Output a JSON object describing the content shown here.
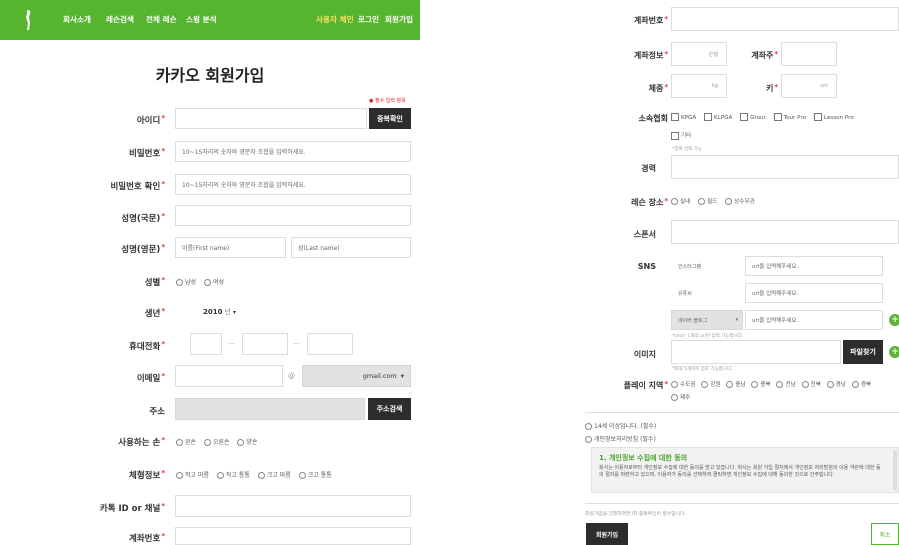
{
  "nav": {
    "items": [
      "회사소개",
      "레슨검색",
      "전체 레슨",
      "스윙 분석"
    ],
    "right": [
      "사용자 체인",
      "로그인",
      "회원가입"
    ]
  },
  "form": {
    "title": "카카오 회원가입",
    "required_note": "● 필수 입력 항목",
    "id_label": "아이디",
    "dup_check_button": "중복확인",
    "pw_label": "비밀번호",
    "pw_placeholder": "10~15자리의 숫자와 영문자 조합을 입력하세요.",
    "pw_confirm_label": "비밀번호 확인",
    "pw_confirm_placeholder": "10~15자리의 숫자와 영문자 조합을 입력하세요.",
    "name_kr_label": "성명(국문)",
    "name_en_label": "성명(영문)",
    "first_name_placeholder": "이름(First name)",
    "last_name_placeholder": "성(Last name)",
    "gender_label": "성별",
    "gender_options": [
      "남성",
      "여성"
    ],
    "birth_label": "생년",
    "birth_year": "2010",
    "birth_unit": "년",
    "phone_label": "휴대전화",
    "phone_sep": "—",
    "email_label": "이메일",
    "email_at": "@",
    "email_domain": "gmail.com",
    "address_label": "주소",
    "address_button": "주소검색",
    "hand_label": "사용하는 손",
    "hand_options": [
      "왼손",
      "오른손",
      "양손"
    ],
    "body_label": "체형정보",
    "body_options": [
      "작고 마름",
      "작고 통통",
      "크고 마름",
      "크고 통통"
    ],
    "kakao_label": "카톡 ID or 채널",
    "account_label": "계좌번호"
  },
  "right": {
    "account_no_label": "계좌번호",
    "account_info_label": "계좌정보",
    "bank_unit": "은행",
    "holder_label": "계좌주",
    "weight_label": "체중",
    "weight_unit": "kg",
    "height_label": "키",
    "height_unit": "cm",
    "assoc_label": "소속협회",
    "assoc_options": [
      "KPGA",
      "KLPGA",
      "Gtour",
      "Tour Pro",
      "Lesson Pro",
      "기타"
    ],
    "assoc_hint": "*중복 선택 가능",
    "career_label": "경력",
    "lesson_place_label": "레슨 장소",
    "lesson_place_options": [
      "실내",
      "필드",
      "상수무관"
    ],
    "sponsor_label": "스폰서",
    "sns_label": "SNS",
    "sns_rows": [
      {
        "name": "인스타그램",
        "placeholder": "url을 입력해주세요."
      },
      {
        "name": "유튜브",
        "placeholder": "url을 입력해주세요."
      },
      {
        "name": "네이버 블로그",
        "placeholder": "url을 입력해주세요."
      }
    ],
    "sns_hint": "*sns는 1개의 url만 입력 가능합니다.",
    "image_label": "이미지",
    "file_button": "파일찾기",
    "image_hint": "*최대 5개까지 업로 가능합니다.",
    "region_label": "플레이 지역",
    "region_options": [
      "수도권",
      "강원",
      "충남",
      "충북",
      "전남",
      "전북",
      "경남",
      "경북",
      "제주"
    ],
    "agree_age": "14세 이상입니다. (필수)",
    "agree_privacy": "개인정보처리방침 (필수)",
    "privacy_title": "1. 개인정보 수집에 대한 동의",
    "privacy_text": "회사는 이용자로부터 개인정보 수집에 대한 동의를 받고 있습니다. 회사는 회원 가입 절차에서 개인정보 처리방침의 이용 약관에 대한 동의 절차를 마련하고 있으며, 이용자가 동의를 선택하여 클릭하면 개인정보 수집에 대해 동의한 것으로 간주합니다.",
    "bottom_note": "회원가입을 진행하려면 ID 중복확인이 필수입니다.",
    "signup_button": "회원가입",
    "cancel_button": "취소"
  },
  "colors": {
    "nav": "#56b52f",
    "accent": "#e8252a",
    "button": "#2d2d2d",
    "privacy_title": "#4aa02e"
  }
}
